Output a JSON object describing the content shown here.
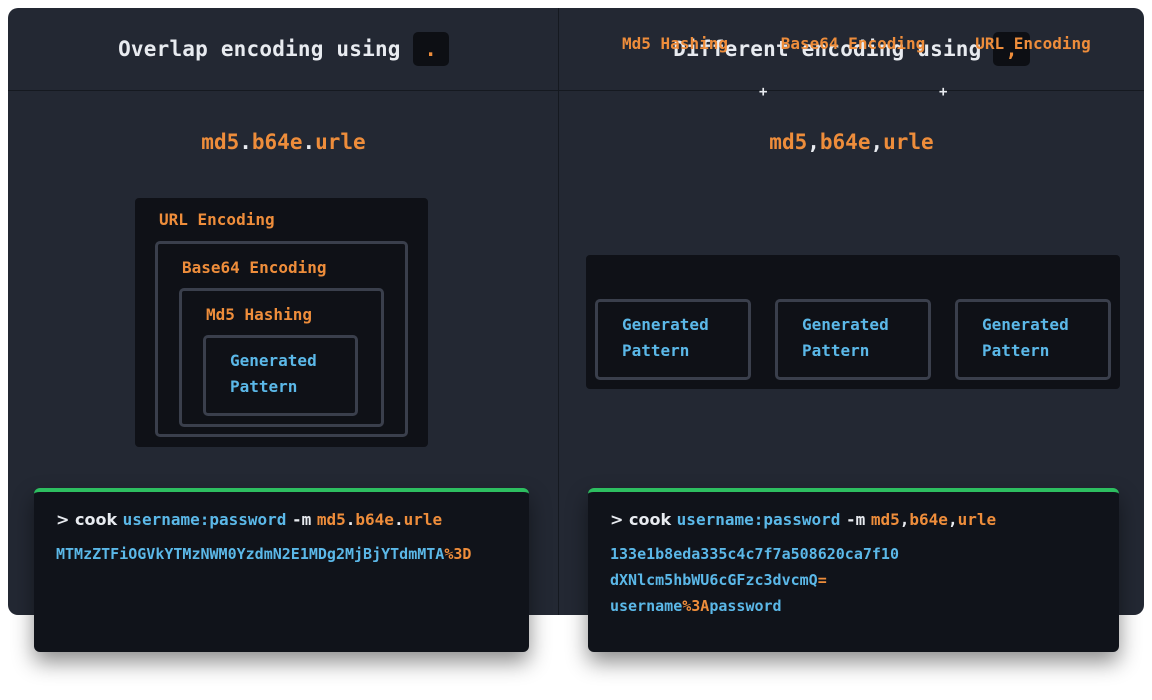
{
  "left": {
    "header_text": "Overlap encoding using",
    "header_sep": ".",
    "formula": [
      "md5",
      ".",
      "b64e",
      ".",
      "urle"
    ],
    "boxes": {
      "url": "URL Encoding",
      "base64": "Base64 Encoding",
      "md5": "Md5 Hashing",
      "pattern_line1": "Generated",
      "pattern_line2": "Pattern"
    },
    "terminal": {
      "prompt": ">",
      "cmd": "cook",
      "arg": "username:password",
      "flag": "-m",
      "methods": [
        "md5",
        ".",
        "b64e",
        ".",
        "urle"
      ],
      "output_main": "MTMzZTFiOGVkYTMzNWM0YzdmN2E1MDg2MjBjYTdmMTA",
      "output_suffix": "%3D"
    }
  },
  "right": {
    "header_text": "Different encoding using",
    "header_sep": ",",
    "formula": [
      "md5",
      ",",
      "b64e",
      ",",
      "urle"
    ],
    "columns": [
      {
        "label": "Md5 Hashing",
        "line1": "Generated",
        "line2": "Pattern"
      },
      {
        "label": "Base64 Encoding",
        "line1": "Generated",
        "line2": "Pattern"
      },
      {
        "label": "URL Encoding",
        "line1": "Generated",
        "line2": "Pattern"
      }
    ],
    "plus": "+",
    "terminal": {
      "prompt": ">",
      "cmd": "cook",
      "arg": "username:password",
      "flag": "-m",
      "methods": [
        "md5",
        ",",
        "b64e",
        ",",
        "urle"
      ],
      "out1": "133e1b8eda335c4c7f7a508620ca7f10",
      "out2_main": "dXNlcm5hbWU6cGFzc3dvcmQ",
      "out2_suffix": "=",
      "out3_a": "username",
      "out3_b": "%3A",
      "out3_c": "password"
    }
  },
  "colors": {
    "background": "#232833",
    "accent_orange": "#ee8d3b",
    "accent_blue": "#5bb8e8",
    "terminal_border": "#2dbe60"
  }
}
